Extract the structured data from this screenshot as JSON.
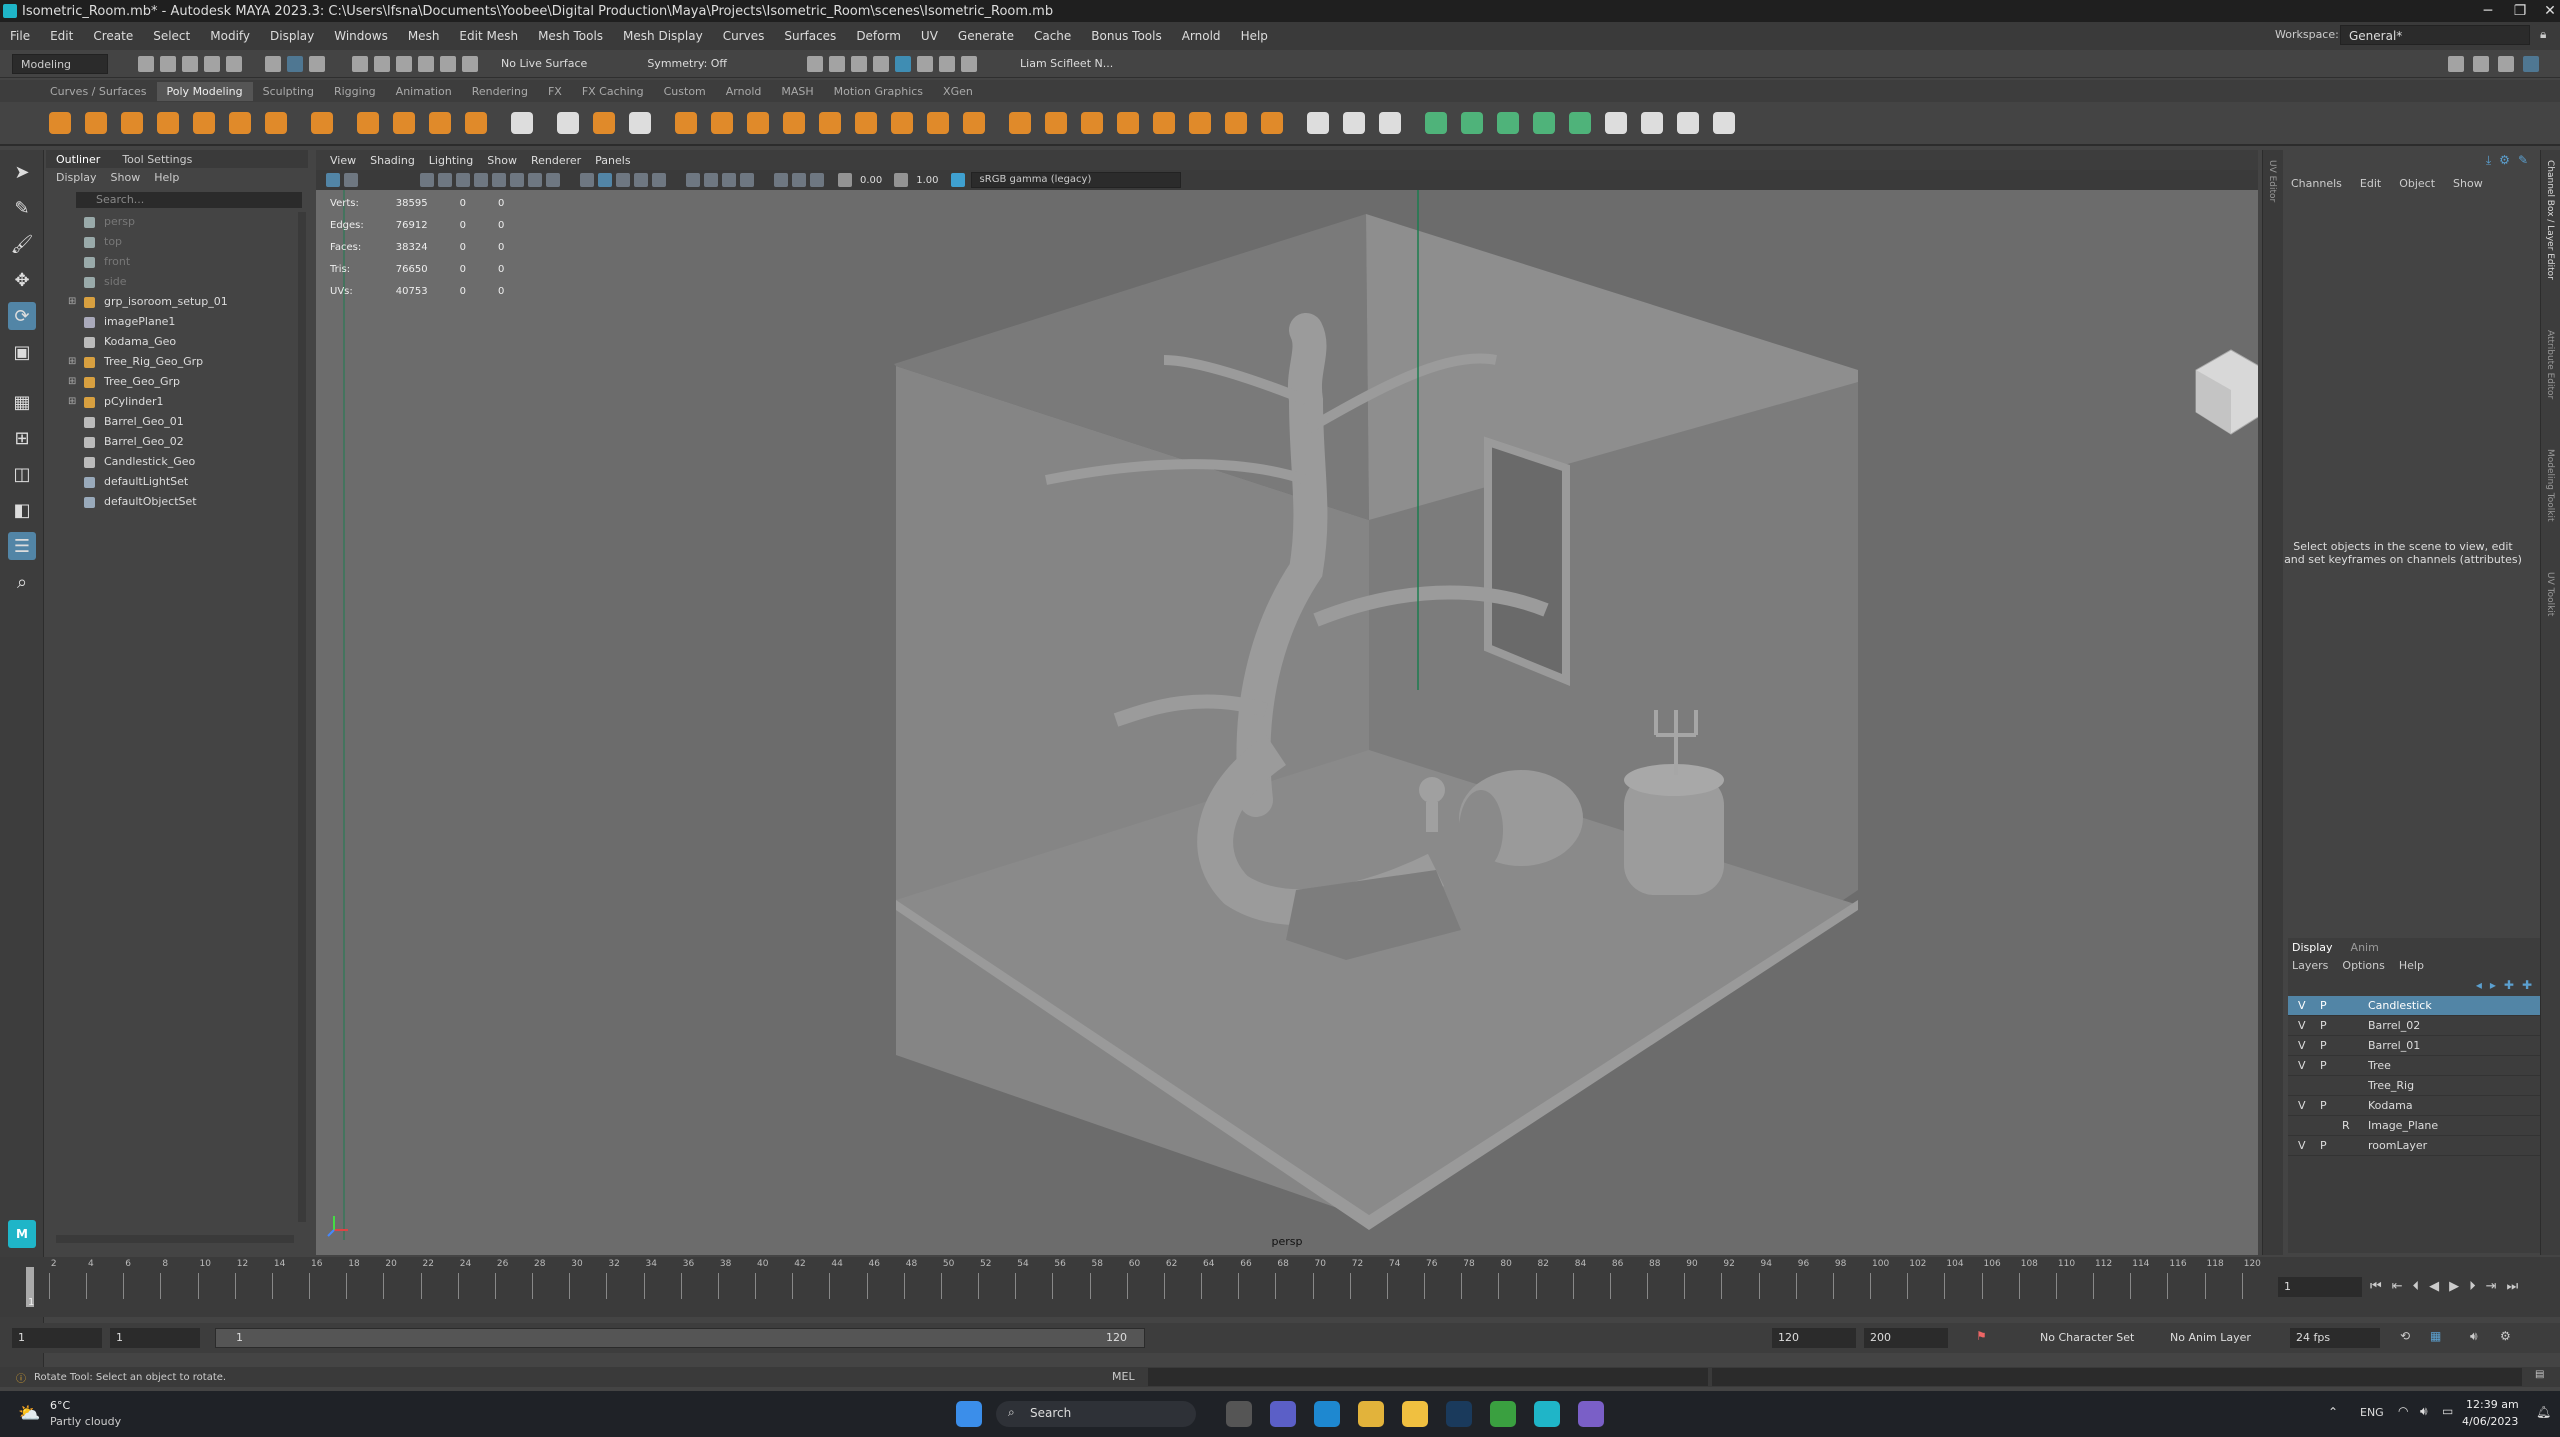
{
  "window": {
    "title": "Isometric_Room.mb* - Autodesk MAYA 2023.3: C:\\Users\\lfsna\\Documents\\Yoobee\\Digital Production\\Maya\\Projects\\Isometric_Room\\scenes\\Isometric_Room.mb"
  },
  "menubar": [
    "File",
    "Edit",
    "Create",
    "Select",
    "Modify",
    "Display",
    "Windows",
    "Mesh",
    "Edit Mesh",
    "Mesh Tools",
    "Mesh Display",
    "Curves",
    "Surfaces",
    "Deform",
    "UV",
    "Generate",
    "Cache",
    "Bonus Tools",
    "Arnold",
    "Help"
  ],
  "workspace": {
    "label": "Workspace:",
    "value": "General*"
  },
  "statusline": {
    "mode": "Modeling",
    "live_surface": "No Live Surface",
    "symmetry": "Symmetry: Off",
    "user": "Liam Scifleet N..."
  },
  "shelf_tabs": [
    "Curves / Surfaces",
    "Poly Modeling",
    "Sculpting",
    "Rigging",
    "Animation",
    "Rendering",
    "FX",
    "FX Caching",
    "Custom",
    "Arnold",
    "MASH",
    "Motion Graphics",
    "XGen"
  ],
  "shelf_active": "Poly Modeling",
  "outliner": {
    "tabs": [
      "Outliner",
      "Tool Settings"
    ],
    "menu": [
      "Display",
      "Show",
      "Help"
    ],
    "search_placeholder": "Search...",
    "items": [
      {
        "label": "persp",
        "expand": "",
        "dim": true,
        "color": "#9aa"
      },
      {
        "label": "top",
        "expand": "",
        "dim": true,
        "color": "#9aa"
      },
      {
        "label": "front",
        "expand": "",
        "dim": true,
        "color": "#9aa"
      },
      {
        "label": "side",
        "expand": "",
        "dim": true,
        "color": "#9aa"
      },
      {
        "label": "grp_isoroom_setup_01",
        "expand": "⊞",
        "dim": false,
        "color": "#d8a040"
      },
      {
        "label": "imagePlane1",
        "expand": "",
        "dim": false,
        "color": "#aab"
      },
      {
        "label": "Kodama_Geo",
        "expand": "",
        "dim": false,
        "color": "#bbb"
      },
      {
        "label": "Tree_Rig_Geo_Grp",
        "expand": "⊞",
        "dim": false,
        "color": "#d8a040"
      },
      {
        "label": "Tree_Geo_Grp",
        "expand": "⊞",
        "dim": false,
        "color": "#d8a040"
      },
      {
        "label": "pCylinder1",
        "expand": "⊞",
        "dim": false,
        "color": "#d8a040"
      },
      {
        "label": "Barrel_Geo_01",
        "expand": "",
        "dim": false,
        "color": "#bbb"
      },
      {
        "label": "Barrel_Geo_02",
        "expand": "",
        "dim": false,
        "color": "#bbb"
      },
      {
        "label": "Candlestick_Geo",
        "expand": "",
        "dim": false,
        "color": "#bbb"
      },
      {
        "label": "defaultLightSet",
        "expand": "",
        "dim": false,
        "color": "#9ab"
      },
      {
        "label": "defaultObjectSet",
        "expand": "",
        "dim": false,
        "color": "#9ab"
      }
    ]
  },
  "viewport": {
    "menu": [
      "View",
      "Shading",
      "Lighting",
      "Show",
      "Renderer",
      "Panels"
    ],
    "exposure": "0.00",
    "gamma": "1.00",
    "colorspace": "sRGB gamma (legacy)",
    "camera": "persp",
    "hud": [
      {
        "label": "Verts:",
        "a": "38595",
        "b": "0",
        "c": "0"
      },
      {
        "label": "Edges:",
        "a": "76912",
        "b": "0",
        "c": "0"
      },
      {
        "label": "Faces:",
        "a": "38324",
        "b": "0",
        "c": "0"
      },
      {
        "label": "Tris:",
        "a": "76650",
        "b": "0",
        "c": "0"
      },
      {
        "label": "UVs:",
        "a": "40753",
        "b": "0",
        "c": "0"
      }
    ]
  },
  "channelbox": {
    "menu": [
      "Channels",
      "Edit",
      "Object",
      "Show"
    ],
    "message": "Select objects in the scene to view, edit and set keyframes on channels (attributes)"
  },
  "side_tabs": [
    "Channel Box / Layer Editor",
    "Attribute Editor",
    "Modeling Toolkit",
    "UV Toolkit"
  ],
  "uv_editor_label": "UV Editor",
  "layers": {
    "tabs": [
      "Display",
      "Anim"
    ],
    "menu": [
      "Layers",
      "Options",
      "Help"
    ],
    "items": [
      {
        "v": "V",
        "p": "P",
        "r": "",
        "name": "Candlestick",
        "selected": true
      },
      {
        "v": "V",
        "p": "P",
        "r": "",
        "name": "Barrel_02",
        "selected": false
      },
      {
        "v": "V",
        "p": "P",
        "r": "",
        "name": "Barrel_01",
        "selected": false
      },
      {
        "v": "V",
        "p": "P",
        "r": "",
        "name": "Tree",
        "selected": false
      },
      {
        "v": "",
        "p": "",
        "r": "",
        "name": "Tree_Rig",
        "selected": false
      },
      {
        "v": "V",
        "p": "P",
        "r": "",
        "name": "Kodama",
        "selected": false
      },
      {
        "v": "",
        "p": "",
        "r": "R",
        "name": "Image_Plane",
        "selected": false
      },
      {
        "v": "V",
        "p": "P",
        "r": "",
        "name": "roomLayer",
        "selected": false
      }
    ]
  },
  "timeline": {
    "ticks": [
      "2",
      "4",
      "6",
      "8",
      "10",
      "12",
      "14",
      "16",
      "18",
      "20",
      "22",
      "24",
      "26",
      "28",
      "30",
      "32",
      "34",
      "36",
      "38",
      "40",
      "42",
      "44",
      "46",
      "48",
      "50",
      "52",
      "54",
      "56",
      "58",
      "60",
      "62",
      "64",
      "66",
      "68",
      "70",
      "72",
      "74",
      "76",
      "78",
      "80",
      "82",
      "84",
      "86",
      "88",
      "90",
      "92",
      "94",
      "96",
      "98",
      "100",
      "102",
      "104",
      "106",
      "108",
      "110",
      "112",
      "114",
      "116",
      "118",
      "120"
    ],
    "current": "1",
    "current_field": "1"
  },
  "range": {
    "start": "1",
    "start2": "1",
    "slider_start": "1",
    "slider_end": "120",
    "end": "120",
    "end2": "200",
    "char_set": "No Character Set",
    "anim_layer": "No Anim Layer",
    "fps": "24 fps"
  },
  "cmdline": {
    "lang": "MEL",
    "help": "Rotate Tool: Select an object to rotate."
  },
  "taskbar": {
    "weather_temp": "6°C",
    "weather_desc": "Partly cloudy",
    "search": "Search",
    "lang": "ENG",
    "time": "12:39 am",
    "date": "4/06/2023"
  },
  "colors": {
    "accent": "#5285a6",
    "shelf_orange": "#e08a2a",
    "viewport_bg": "#6c6c6c"
  }
}
